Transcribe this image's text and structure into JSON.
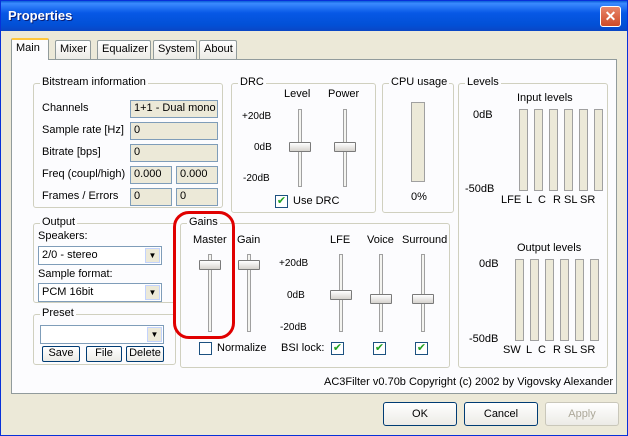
{
  "window": {
    "title": "Properties"
  },
  "tabs": [
    "Main",
    "Mixer",
    "Equalizer",
    "System",
    "About"
  ],
  "bitstream": {
    "title": "Bitstream information",
    "rows": [
      {
        "label": "Channels",
        "value": "1+1 - Dual mono"
      },
      {
        "label": "Sample rate [Hz]",
        "value": "0"
      },
      {
        "label": "Bitrate [bps]",
        "value": "0"
      },
      {
        "label": "Freq (coupl/high)",
        "value1": "0.000",
        "value2": "0.000"
      },
      {
        "label": "Frames / Errors",
        "value1": "0",
        "value2": "0"
      }
    ]
  },
  "drc": {
    "title": "DRC",
    "level_label": "Level",
    "power_label": "Power",
    "ticks": [
      "+20dB",
      "0dB",
      "-20dB"
    ],
    "use_drc_label": "Use DRC",
    "use_drc_checked": true
  },
  "cpu": {
    "title": "CPU usage",
    "value": "0%"
  },
  "levels": {
    "title": "Levels",
    "input_title": "Input levels",
    "output_title": "Output levels",
    "top_label": "0dB",
    "bottom_label": "-50dB",
    "input_channels": [
      "LFE",
      "L",
      "C",
      "R",
      "SL",
      "SR"
    ],
    "output_channels": [
      "SW",
      "L",
      "C",
      "R",
      "SL",
      "SR"
    ]
  },
  "output": {
    "title": "Output",
    "speakers_label": "Speakers:",
    "speakers_value": "2/0 - stereo",
    "format_label": "Sample format:",
    "format_value": "PCM 16bit"
  },
  "preset": {
    "title": "Preset",
    "value": "",
    "save": "Save",
    "file": "File",
    "delete": "Delete"
  },
  "gains": {
    "title": "Gains",
    "master": "Master",
    "gain": "Gain",
    "lfe": "LFE",
    "voice": "Voice",
    "surround": "Surround",
    "ticks": [
      "+20dB",
      "0dB",
      "-20dB"
    ],
    "normalize": "Normalize",
    "bsi_lock": "BSI lock:",
    "lfe_checked": true,
    "voice_checked": true,
    "surround_checked": true
  },
  "copyright": "AC3Filter v0.70b Copyright (c) 2002 by Vigovsky Alexander",
  "buttons": {
    "ok": "OK",
    "cancel": "Cancel",
    "apply": "Apply"
  },
  "colors": {
    "highlight_ring": "#e00000",
    "title_bar": "#0250d6"
  }
}
